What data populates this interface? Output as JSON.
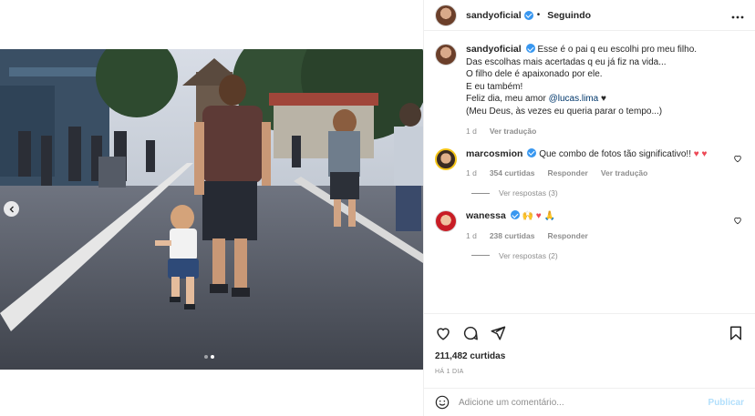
{
  "post": {
    "author": "sandyoficial",
    "follow_label": "Seguindo",
    "dot_separator": "•",
    "more_icon": "more-horizontal-icon",
    "carousel_total": 2,
    "carousel_active": 2
  },
  "caption": {
    "lines": [
      "Esse é o pai q eu escolhi pro meu filho.",
      "Das escolhas mais acertadas q eu já fiz na vida...",
      "O filho dele é apaixonado por ele.",
      "E eu também!",
      "Feliz dia, meu amor ",
      "(Meu Deus, às vezes eu queria parar o tempo...)"
    ],
    "mention": "@lucas.lima",
    "mention_suffix": " ♥",
    "age": "1 d",
    "translate": "Ver tradução"
  },
  "comments": [
    {
      "author": "marcosmion",
      "text": "Que combo de fotos tão significativo!! ",
      "emoji": "♥ ♥",
      "age": "1 d",
      "likes": "354 curtidas",
      "reply": "Responder",
      "translate": "Ver tradução",
      "view_replies": "Ver respostas (3)"
    },
    {
      "author": "wanessa",
      "text": "🙌 ♥ 🙏",
      "age": "1 d",
      "likes": "238 curtidas",
      "reply": "Responder",
      "view_replies": "Ver respostas (2)"
    }
  ],
  "stats": {
    "likes": "211,482 curtidas",
    "time": "HÁ 1 DIA"
  },
  "composer": {
    "placeholder": "Adicione um comentário...",
    "publish": "Publicar"
  },
  "colors": {
    "link": "#00376b",
    "verified": "#3897f0",
    "heart": "#ed4956",
    "publish_disabled": "#b2dffc"
  }
}
